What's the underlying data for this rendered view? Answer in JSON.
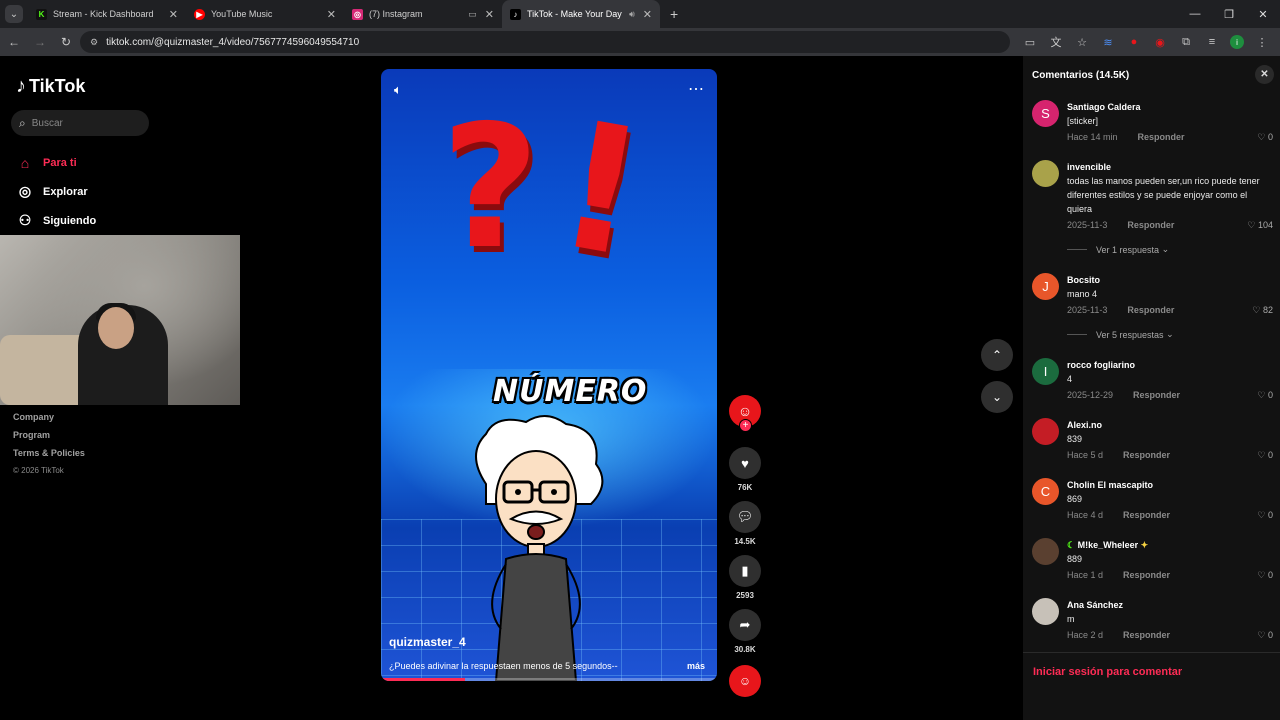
{
  "browser": {
    "tabs": [
      {
        "title": "Stream - Kick Dashboard",
        "fav_bg": "#111",
        "fav_color": "#53fc18",
        "fav_glyph": "K"
      },
      {
        "title": "YouTube Music",
        "fav_bg": "#ff0000",
        "fav_color": "#fff",
        "fav_glyph": "▶"
      },
      {
        "title": "(7) Instagram",
        "fav_bg": "#d62976",
        "fav_color": "#fff",
        "fav_glyph": "◎"
      },
      {
        "title": "TikTok - Make Your Day",
        "fav_bg": "#000",
        "fav_color": "#fff",
        "fav_glyph": "♪"
      }
    ],
    "url": "tiktok.com/@quizmaster_4/video/7567774596049554710"
  },
  "sidebar": {
    "logo_text": "TikTok",
    "search_placeholder": "Buscar",
    "nav": [
      {
        "label": "Para ti",
        "icon": "home-icon",
        "active": true
      },
      {
        "label": "Explorar",
        "icon": "compass-icon",
        "active": false
      },
      {
        "label": "Siguiendo",
        "icon": "following-icon",
        "active": false
      }
    ],
    "footer": [
      "Company",
      "Program",
      "Terms & Policies"
    ],
    "copyright": "© 2026 TikTok"
  },
  "video": {
    "overlay_text": "NÚMERO",
    "username": "quizmaster_4",
    "caption": "¿Puedes adivinar la respuestaen menos de 5 segundos--",
    "more_label": "más",
    "progress": 0.25,
    "accent": "#fe2c55"
  },
  "actions": {
    "likes": "76K",
    "comments": "14.5K",
    "saves": "2593",
    "shares": "30.8K"
  },
  "comments_panel": {
    "title": "Comentarios (14.5K)",
    "reply_label": "Responder",
    "login_label": "Iniciar sesión para comentar",
    "items": [
      {
        "name": "Santiago Caldera",
        "text": "[sticker]",
        "time": "Hace 14 min",
        "likes": "0",
        "avatar": "S",
        "avatar_bg": "#d6246e"
      },
      {
        "name": "invencible",
        "text": "todas las manos pueden ser,un rico puede tener diferentes estilos y se puede enjoyar como el quiera",
        "time": "2025-11-3",
        "likes": "104",
        "avatar": "",
        "avatar_bg": "#a9a24a",
        "replies": "Ver 1 respuesta"
      },
      {
        "name": "Bocsito",
        "text": "mano 4",
        "time": "2025-11-3",
        "likes": "82",
        "avatar": "J",
        "avatar_bg": "#e8562a",
        "replies": "Ver 5 respuestas"
      },
      {
        "name": "rocco fogliarino",
        "text": "4",
        "time": "2025-12-29",
        "likes": "0",
        "avatar": "I",
        "avatar_bg": "#1b6b3e"
      },
      {
        "name": "Alexi.no",
        "text": "839",
        "time": "Hace 5 d",
        "likes": "0",
        "avatar": "",
        "avatar_bg": "#c41d25"
      },
      {
        "name": "Cholin El mascapito",
        "text": "869",
        "time": "Hace 4 d",
        "likes": "0",
        "avatar": "C",
        "avatar_bg": "#e8562a"
      },
      {
        "name": "M!ke_Wheleer",
        "text": "889",
        "time": "Hace 1 d",
        "likes": "0",
        "avatar": "",
        "avatar_bg": "#5a4030"
      },
      {
        "name": "Ana Sánchez",
        "text": "m",
        "time": "Hace 2 d",
        "likes": "0",
        "avatar": "",
        "avatar_bg": "#c7c1b8"
      }
    ]
  }
}
